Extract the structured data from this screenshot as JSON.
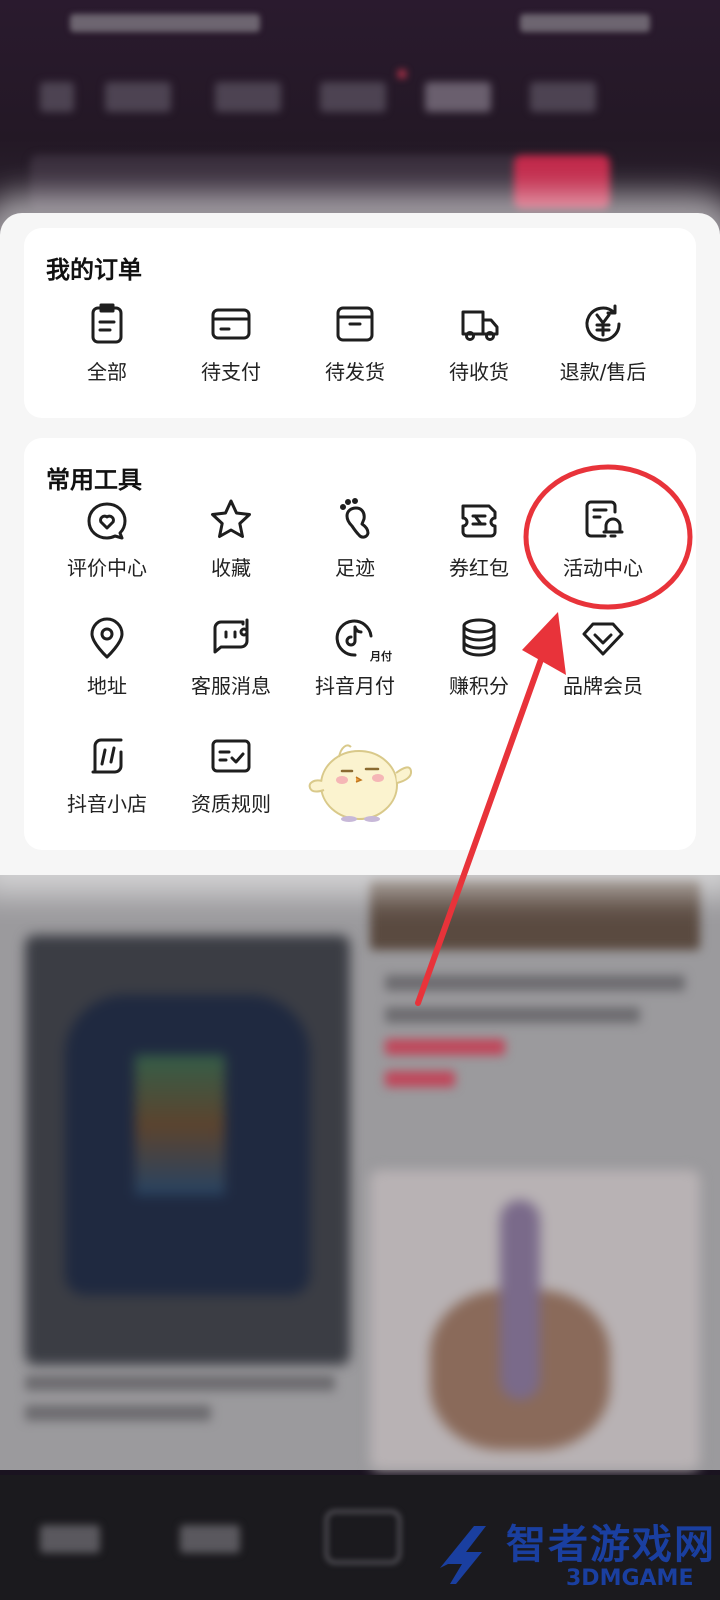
{
  "orders": {
    "title": "我的订单",
    "items": [
      {
        "label": "全部",
        "icon": "clipboard-icon"
      },
      {
        "label": "待支付",
        "icon": "card-icon"
      },
      {
        "label": "待发货",
        "icon": "package-icon"
      },
      {
        "label": "待收货",
        "icon": "truck-icon"
      },
      {
        "label": "退款/售后",
        "icon": "refund-yen-icon"
      }
    ]
  },
  "tools": {
    "title": "常用工具",
    "items": [
      {
        "label": "评价中心",
        "icon": "review-heart-icon"
      },
      {
        "label": "收藏",
        "icon": "star-icon"
      },
      {
        "label": "足迹",
        "icon": "footprint-icon"
      },
      {
        "label": "券红包",
        "icon": "coupon-icon"
      },
      {
        "label": "活动中心",
        "icon": "activity-bell-icon"
      },
      {
        "label": "地址",
        "icon": "location-pin-icon"
      },
      {
        "label": "客服消息",
        "icon": "customer-service-icon"
      },
      {
        "label": "抖音月付",
        "icon": "douyin-monthly-pay-icon",
        "badge": "月付"
      },
      {
        "label": "赚积分",
        "icon": "coins-stack-icon"
      },
      {
        "label": "品牌会员",
        "icon": "brand-member-icon"
      },
      {
        "label": "抖音小店",
        "icon": "douyin-shop-icon"
      },
      {
        "label": "资质规则",
        "icon": "qualification-rules-icon"
      }
    ]
  },
  "annotation": {
    "color": "#e8333a"
  },
  "watermark": {
    "cn": "智者游戏网",
    "en": "3DMGAME"
  }
}
